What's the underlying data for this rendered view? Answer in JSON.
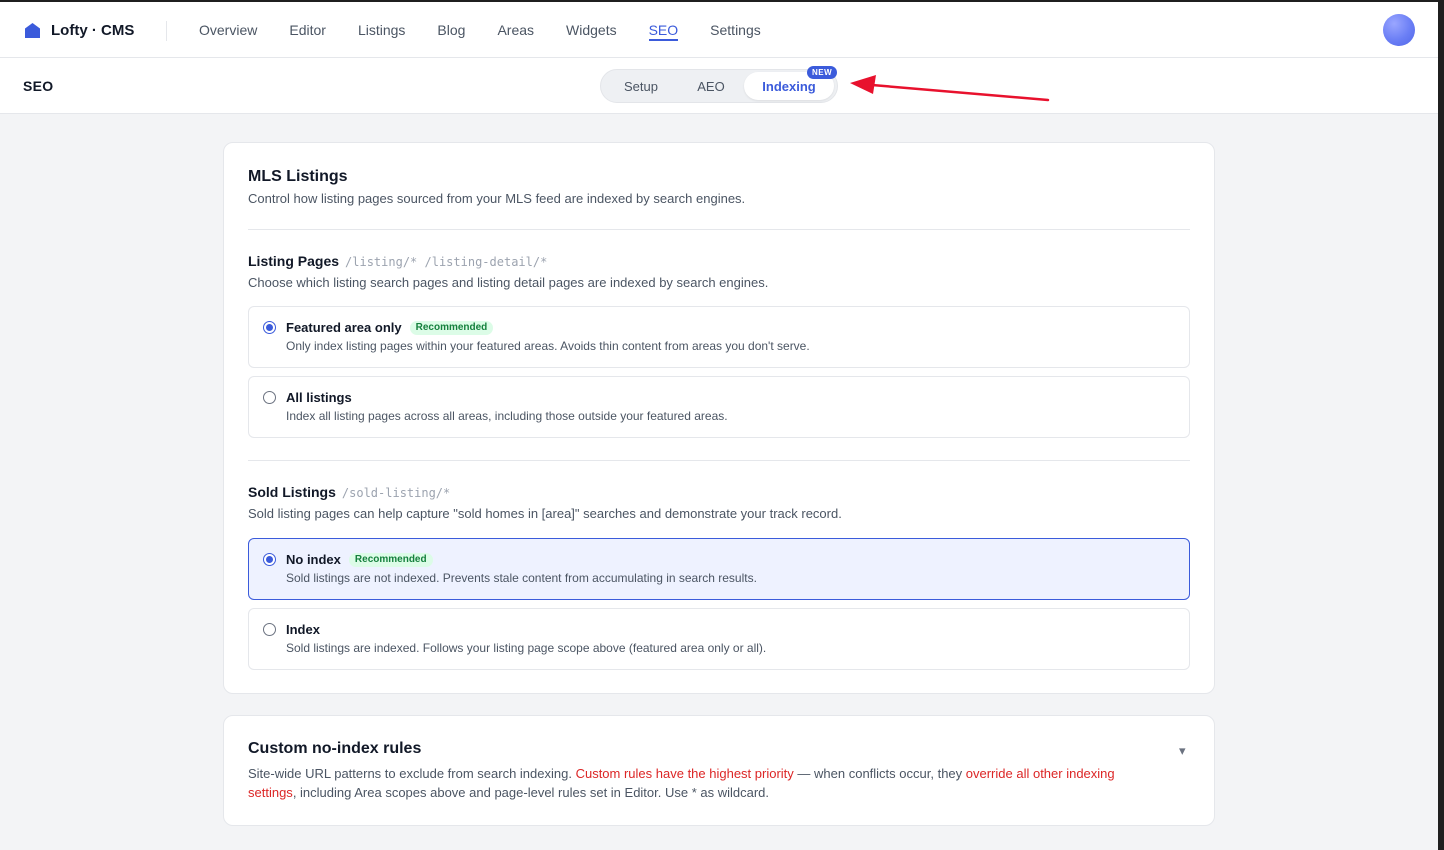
{
  "app": {
    "brand_name": "Lofty · CMS"
  },
  "nav": {
    "items": [
      {
        "label": "Overview"
      },
      {
        "label": "Editor"
      },
      {
        "label": "Listings"
      },
      {
        "label": "Blog"
      },
      {
        "label": "Areas"
      },
      {
        "label": "Widgets"
      },
      {
        "label": "SEO",
        "active": true
      },
      {
        "label": "Settings"
      }
    ]
  },
  "subheader": {
    "title": "SEO",
    "tabs": [
      {
        "label": "Setup"
      },
      {
        "label": "AEO"
      },
      {
        "label": "Indexing",
        "active": true,
        "badge": "NEW"
      }
    ]
  },
  "mls": {
    "title": "MLS Listings",
    "description": "Control how listing pages sourced from your MLS feed are indexed by search engines.",
    "listing_pages": {
      "title": "Listing Pages",
      "paths": "/listing/* /listing-detail/*",
      "description": "Choose which listing search pages and listing detail pages are indexed by search engines.",
      "options": [
        {
          "label": "Featured area only",
          "badge": "Recommended",
          "description": "Only index listing pages within your featured areas. Avoids thin content from areas you don't serve.",
          "selected": true
        },
        {
          "label": "All listings",
          "description": "Index all listing pages across all areas, including those outside your featured areas.",
          "selected": false
        }
      ]
    },
    "sold_listings": {
      "title": "Sold Listings",
      "paths": "/sold-listing/*",
      "description": "Sold listing pages can help capture \"sold homes in [area]\" searches and demonstrate your track record.",
      "options": [
        {
          "label": "No index",
          "badge": "Recommended",
          "description": "Sold listings are not indexed. Prevents stale content from accumulating in search results.",
          "selected": true
        },
        {
          "label": "Index",
          "description": "Sold listings are indexed. Follows your listing page scope above (featured area only or all).",
          "selected": false
        }
      ]
    }
  },
  "rules": {
    "title": "Custom no-index rules",
    "desc_1": "Site-wide URL patterns to exclude from search indexing. ",
    "desc_red_1": "Custom rules have the highest priority",
    "desc_2": " — when conflicts occur, they ",
    "desc_red_2a": "override all other indexing",
    "desc_red_2b": "settings",
    "desc_3": ", including Area scopes above and page-level rules set in Editor. Use * as wildcard.",
    "toggle_glyph": "▾"
  },
  "colors": {
    "accent": "#3b5bdb",
    "recommended_bg": "#dcfce7",
    "recommended_text": "#15803d",
    "warning_red": "#dc2626",
    "annotation_arrow": "#e8112d"
  },
  "icons": {
    "brand": "house-icon",
    "avatar": "user-avatar",
    "collapse": "chevron-down-icon",
    "annotation": "red-arrow-annotation"
  }
}
